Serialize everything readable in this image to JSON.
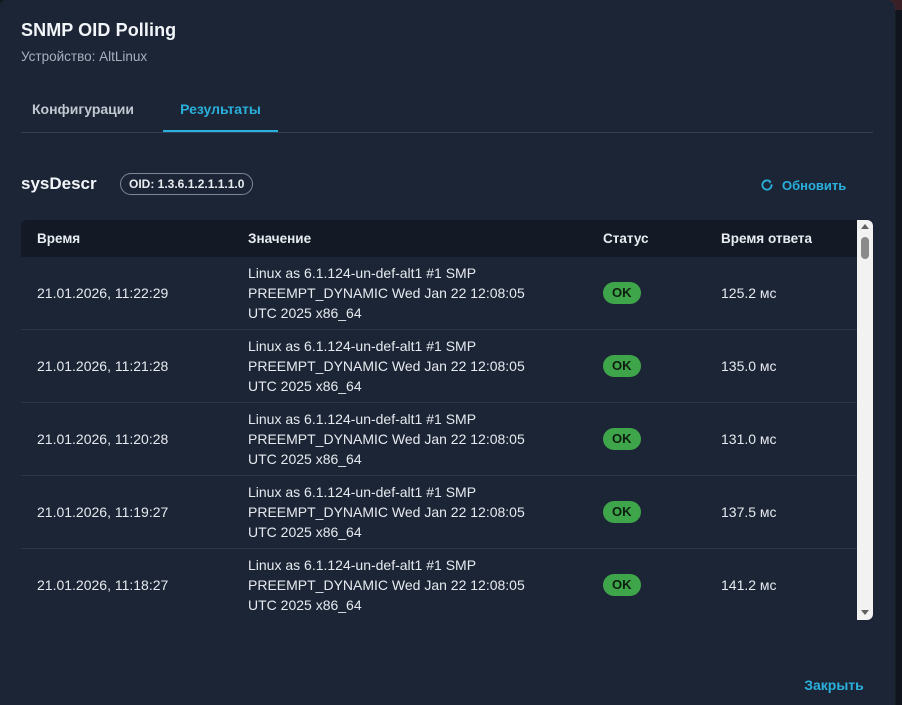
{
  "dialog": {
    "title": "SNMP OID Polling",
    "subtitle": "Устройство: AltLinux"
  },
  "tabs": [
    {
      "label": "Конфигурации",
      "active": false
    },
    {
      "label": "Результаты",
      "active": true
    }
  ],
  "oid": {
    "name": "sysDescr",
    "chip": "OID: 1.3.6.1.2.1.1.1.0"
  },
  "refresh": {
    "label": "Обновить",
    "icon": "refresh-icon"
  },
  "table": {
    "headers": [
      "Время",
      "Значение",
      "Статус",
      "Время ответа"
    ],
    "rows": [
      {
        "time": "21.01.2026, 11:22:29",
        "value": [
          "Linux as 6.1.124-un-def-alt1 #1 SMP",
          "PREEMPT_DYNAMIC Wed Jan 22 12:08:05",
          "UTC 2025 x86_64"
        ],
        "status": "OK",
        "response": "125.2 мс"
      },
      {
        "time": "21.01.2026, 11:21:28",
        "value": [
          "Linux as 6.1.124-un-def-alt1 #1 SMP",
          "PREEMPT_DYNAMIC Wed Jan 22 12:08:05",
          "UTC 2025 x86_64"
        ],
        "status": "OK",
        "response": "135.0 мс"
      },
      {
        "time": "21.01.2026, 11:20:28",
        "value": [
          "Linux as 6.1.124-un-def-alt1 #1 SMP",
          "PREEMPT_DYNAMIC Wed Jan 22 12:08:05",
          "UTC 2025 x86_64"
        ],
        "status": "OK",
        "response": "131.0 мс"
      },
      {
        "time": "21.01.2026, 11:19:27",
        "value": [
          "Linux as 6.1.124-un-def-alt1 #1 SMP",
          "PREEMPT_DYNAMIC Wed Jan 22 12:08:05",
          "UTC 2025 x86_64"
        ],
        "status": "OK",
        "response": "137.5 мс"
      },
      {
        "time": "21.01.2026, 11:18:27",
        "value": [
          "Linux as 6.1.124-un-def-alt1 #1 SMP",
          "PREEMPT_DYNAMIC Wed Jan 22 12:08:05",
          "UTC 2025 x86_64"
        ],
        "status": "OK",
        "response": "141.2 мс"
      }
    ]
  },
  "footer": {
    "close_label": "Закрыть"
  },
  "colors": {
    "accent": "#2ab0dc",
    "ok_badge": "#3fa54a",
    "dialog_bg": "#1c2535",
    "table_header_bg": "#131a25"
  }
}
